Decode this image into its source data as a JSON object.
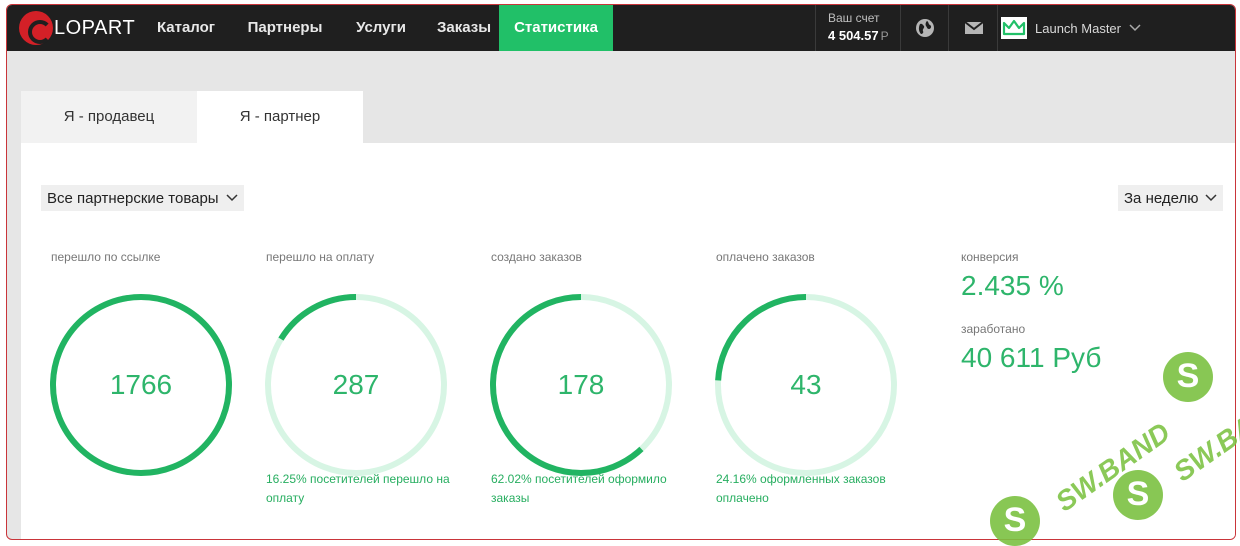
{
  "brand": {
    "logo_text": "LOPART",
    "logo_letter": "G"
  },
  "nav": {
    "items": [
      {
        "label": "Каталог"
      },
      {
        "label": "Партнеры"
      },
      {
        "label": "Услуги"
      },
      {
        "label": "Заказы"
      },
      {
        "label": "Статистика",
        "active": true
      }
    ]
  },
  "account": {
    "label": "Ваш счет",
    "value": "4 504.57",
    "currency": "Р"
  },
  "header_icons": [
    "globe-icon",
    "mail-icon"
  ],
  "user": {
    "name": "Launch Master",
    "avatar_icon": "crown-icon"
  },
  "tabs": [
    {
      "label": "Я - продавец"
    },
    {
      "label": "Я - партнер",
      "active": true
    }
  ],
  "filters": {
    "products": "Все партнерские товары",
    "period": "За неделю"
  },
  "metrics": [
    {
      "label": "перешло по ссылке",
      "value": "1766",
      "fill": 1.0,
      "note": ""
    },
    {
      "label": "перешло на оплату",
      "value": "287",
      "fill": 0.1625,
      "note": "16.25% посетителей перешло на оплату"
    },
    {
      "label": "создано заказов",
      "value": "178",
      "fill": 0.6202,
      "note": "62.02% посетителей оформило заказы"
    },
    {
      "label": "оплачено заказов",
      "value": "43",
      "fill": 0.2416,
      "note": "24.16% оформленных заказов оплачено"
    }
  ],
  "summary": {
    "conversion_label": "конверсия",
    "conversion_value": "2.435 %",
    "earned_label": "заработано",
    "earned_value": "40 611 Руб"
  },
  "watermark": {
    "text": "SW.BAND",
    "letter": "S"
  },
  "colors": {
    "accent": "#21c068",
    "ring_track": "#d7f5e4",
    "ring_fill": "#21b462",
    "navbar": "#1f1f1f",
    "frame_border": "#c9353a"
  }
}
